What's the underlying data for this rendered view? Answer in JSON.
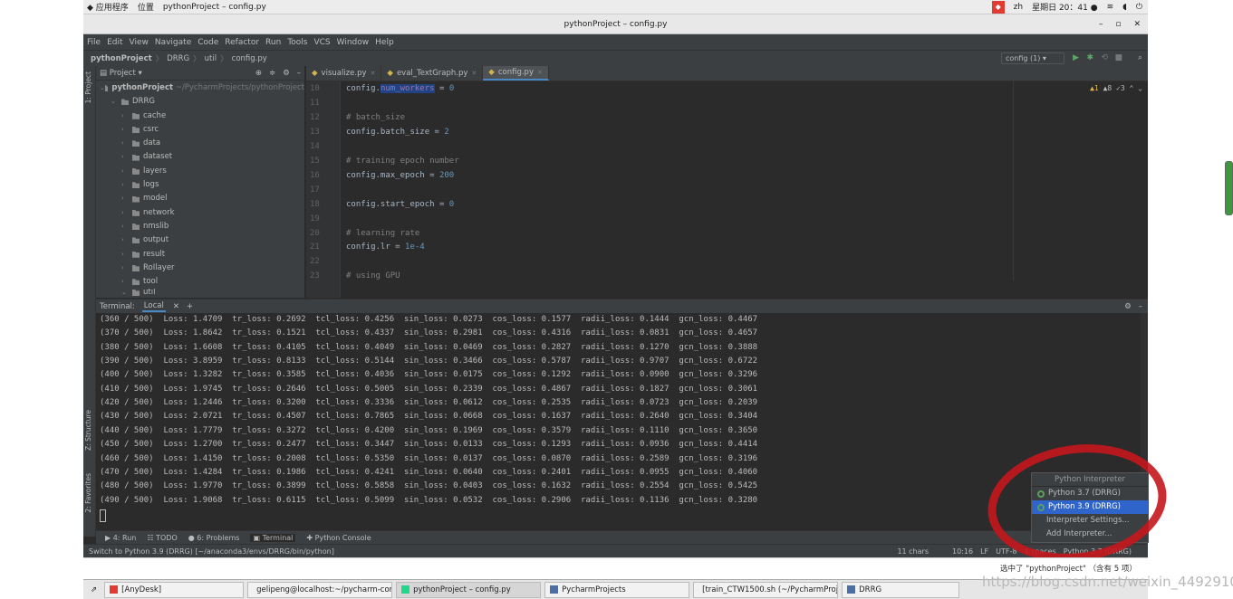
{
  "sysbar": {
    "apps": "应用程序",
    "places": "位置",
    "window": "pythonProject – config.py",
    "lang": "zh",
    "clock": "星期日 20：41 ●"
  },
  "titlebar": {
    "title": "pythonProject – config.py"
  },
  "menu": [
    "File",
    "Edit",
    "View",
    "Navigate",
    "Code",
    "Refactor",
    "Run",
    "Tools",
    "VCS",
    "Window",
    "Help"
  ],
  "breadcrumb": {
    "project": "pythonProject",
    "p1": "DRRG",
    "p2": "util",
    "file": "config.py"
  },
  "runconfig": "config (1)",
  "project": {
    "header": "Project",
    "root": "pythonProject",
    "root_path": "~/PycharmProjects/pythonProject",
    "drrg": "DRRG",
    "folders": [
      "cache",
      "csrc",
      "data",
      "dataset",
      "layers",
      "logs",
      "model",
      "network",
      "nmslib",
      "output",
      "result",
      "RoIlayer",
      "tool",
      "util"
    ]
  },
  "tabs": [
    {
      "label": "visualize.py"
    },
    {
      "label": "eval_TextGraph.py"
    },
    {
      "label": "config.py"
    }
  ],
  "inspections": {
    "warn": "▲1",
    "weak": "▲8",
    "typo": "✓3"
  },
  "code": {
    "lines": [
      {
        "n": "10",
        "t": "config.",
        "h": "num_workers",
        "t2": " = ",
        "v": "0"
      },
      {
        "n": "11",
        "c": ""
      },
      {
        "n": "12",
        "c": "# batch_size"
      },
      {
        "n": "13",
        "t": "config.batch_size = ",
        "v": "2"
      },
      {
        "n": "14",
        "c": ""
      },
      {
        "n": "15",
        "c": "# training epoch number"
      },
      {
        "n": "16",
        "t": "config.max_epoch = ",
        "v": "200"
      },
      {
        "n": "17",
        "c": ""
      },
      {
        "n": "18",
        "t": "config.start_epoch = ",
        "v": "0"
      },
      {
        "n": "19",
        "c": ""
      },
      {
        "n": "20",
        "c": "# learning rate"
      },
      {
        "n": "21",
        "t": "config.lr = ",
        "v": "1e-4"
      },
      {
        "n": "22",
        "c": ""
      },
      {
        "n": "23",
        "c": "# using GPU"
      }
    ]
  },
  "terminal": {
    "label": "Terminal:",
    "tab": "Local",
    "add": "+",
    "lines": [
      "(360 / 500)  Loss: 1.4709  tr_loss: 0.2692  tcl_loss: 0.4256  sin_loss: 0.0273  cos_loss: 0.1577  radii_loss: 0.1444  gcn_loss: 0.4467",
      "(370 / 500)  Loss: 1.8642  tr_loss: 0.1521  tcl_loss: 0.4337  sin_loss: 0.2981  cos_loss: 0.4316  radii_loss: 0.0831  gcn_loss: 0.4657",
      "(380 / 500)  Loss: 1.6608  tr_loss: 0.4105  tcl_loss: 0.4049  sin_loss: 0.0469  cos_loss: 0.2827  radii_loss: 0.1270  gcn_loss: 0.3888",
      "(390 / 500)  Loss: 3.8959  tr_loss: 0.8133  tcl_loss: 0.5144  sin_loss: 0.3466  cos_loss: 0.5787  radii_loss: 0.9707  gcn_loss: 0.6722",
      "(400 / 500)  Loss: 1.3282  tr_loss: 0.3585  tcl_loss: 0.4036  sin_loss: 0.0175  cos_loss: 0.1292  radii_loss: 0.0900  gcn_loss: 0.3296",
      "(410 / 500)  Loss: 1.9745  tr_loss: 0.2646  tcl_loss: 0.5005  sin_loss: 0.2339  cos_loss: 0.4867  radii_loss: 0.1827  gcn_loss: 0.3061",
      "(420 / 500)  Loss: 1.2446  tr_loss: 0.3200  tcl_loss: 0.3336  sin_loss: 0.0612  cos_loss: 0.2535  radii_loss: 0.0723  gcn_loss: 0.2039",
      "(430 / 500)  Loss: 2.0721  tr_loss: 0.4507  tcl_loss: 0.7865  sin_loss: 0.0668  cos_loss: 0.1637  radii_loss: 0.2640  gcn_loss: 0.3404",
      "(440 / 500)  Loss: 1.7779  tr_loss: 0.3272  tcl_loss: 0.4200  sin_loss: 0.1969  cos_loss: 0.3579  radii_loss: 0.1110  gcn_loss: 0.3650",
      "(450 / 500)  Loss: 1.2700  tr_loss: 0.2477  tcl_loss: 0.3447  sin_loss: 0.0133  cos_loss: 0.1293  radii_loss: 0.0936  gcn_loss: 0.4414",
      "(460 / 500)  Loss: 1.4150  tr_loss: 0.2008  tcl_loss: 0.5350  sin_loss: 0.0137  cos_loss: 0.0870  radii_loss: 0.2589  gcn_loss: 0.3196",
      "(470 / 500)  Loss: 1.4284  tr_loss: 0.1986  tcl_loss: 0.4241  sin_loss: 0.0640  cos_loss: 0.2401  radii_loss: 0.0955  gcn_loss: 0.4060",
      "(480 / 500)  Loss: 1.9770  tr_loss: 0.3899  tcl_loss: 0.5858  sin_loss: 0.0403  cos_loss: 0.1632  radii_loss: 0.2554  gcn_loss: 0.5425",
      "(490 / 500)  Loss: 1.9068  tr_loss: 0.6115  tcl_loss: 0.5099  sin_loss: 0.0532  cos_loss: 0.2906  radii_loss: 0.1136  gcn_loss: 0.3280"
    ]
  },
  "bottomtools": [
    "4: Run",
    "TODO",
    "6: Problems",
    "Terminal",
    "Python Console"
  ],
  "status": {
    "msg": "Switch to Python 3.9 (DRRG) [~/anaconda3/envs/DRRG/bin/python]",
    "chars": "11 chars",
    "pos": "10:16",
    "lf": "LF",
    "enc": "UTF-8",
    "indent": "4 spaces",
    "interp": "Python 3.7 (DRRG)"
  },
  "popup": {
    "header": "Python Interpreter",
    "items": [
      "Python 3.7 (DRRG)",
      "Python 3.9 (DRRG)",
      "Interpreter Settings...",
      "Add Interpreter..."
    ]
  },
  "notification": "选中了 \"pythonProject\" （含有 5 项）",
  "taskbar": [
    {
      "label": "[AnyDesk]"
    },
    {
      "label": "gelipeng@localhost:~/pycharm-com..."
    },
    {
      "label": "pythonProject – config.py"
    },
    {
      "label": "PycharmProjects"
    },
    {
      "label": "[train_CTW1500.sh (~/PycharmProj..."
    },
    {
      "label": "DRRG"
    }
  ],
  "watermark": "https://blog.csdn.net/weixin_44929101",
  "lefttools": {
    "project": "1: Project",
    "structure": "Z: Structure",
    "favorites": "2: Favorites"
  }
}
